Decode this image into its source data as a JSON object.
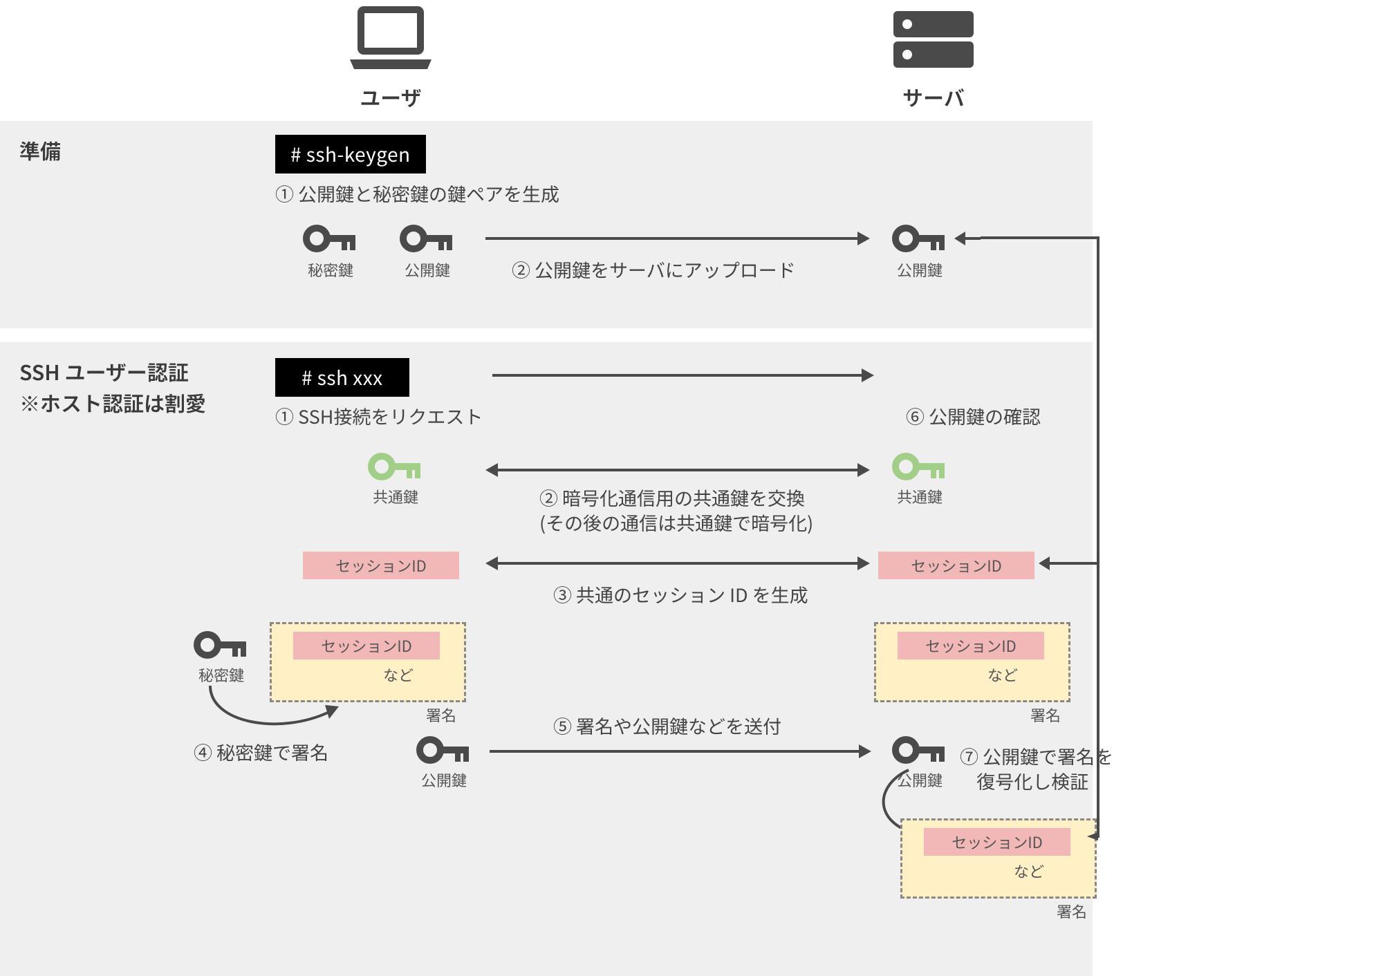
{
  "columns": {
    "user": "ユーザ",
    "server": "サーバ"
  },
  "sections": {
    "prep": {
      "title": "準備",
      "cmd": "# ssh-keygen",
      "step1": "① 公開鍵と秘密鍵の鍵ペアを生成",
      "step2": "② 公開鍵をサーバにアップロード",
      "key_private": "秘密鍵",
      "key_public": "公開鍵",
      "server_public": "公開鍵"
    },
    "auth": {
      "title": "SSH ユーザー認証",
      "title_sub": "※ホスト認証は割愛",
      "cmd": "# ssh xxx",
      "step1": "① SSH接続をリクエスト",
      "step2a": "② 暗号化通信用の共通鍵を交換",
      "step2b": "(その後の通信は共通鍵で暗号化)",
      "step3": "③ 共通のセッション ID を生成",
      "step4": "④ 秘密鍵で署名",
      "step5": "⑤ 署名や公開鍵などを送付",
      "step6": "⑥ 公開鍵の確認",
      "step7a": "⑦ 公開鍵で署名を",
      "step7b": "    復号化し検証",
      "common_key": "共通鍵",
      "session_id": "セッションID",
      "etc": "など",
      "signature": "署名",
      "key_private": "秘密鍵",
      "key_public": "公開鍵"
    }
  },
  "colors": {
    "icon_dark": "#4a4a4a",
    "icon_green": "#a2cf88",
    "pink": "#f2b8b8",
    "cream": "#fff0c6",
    "section_bg": "#efefef"
  }
}
